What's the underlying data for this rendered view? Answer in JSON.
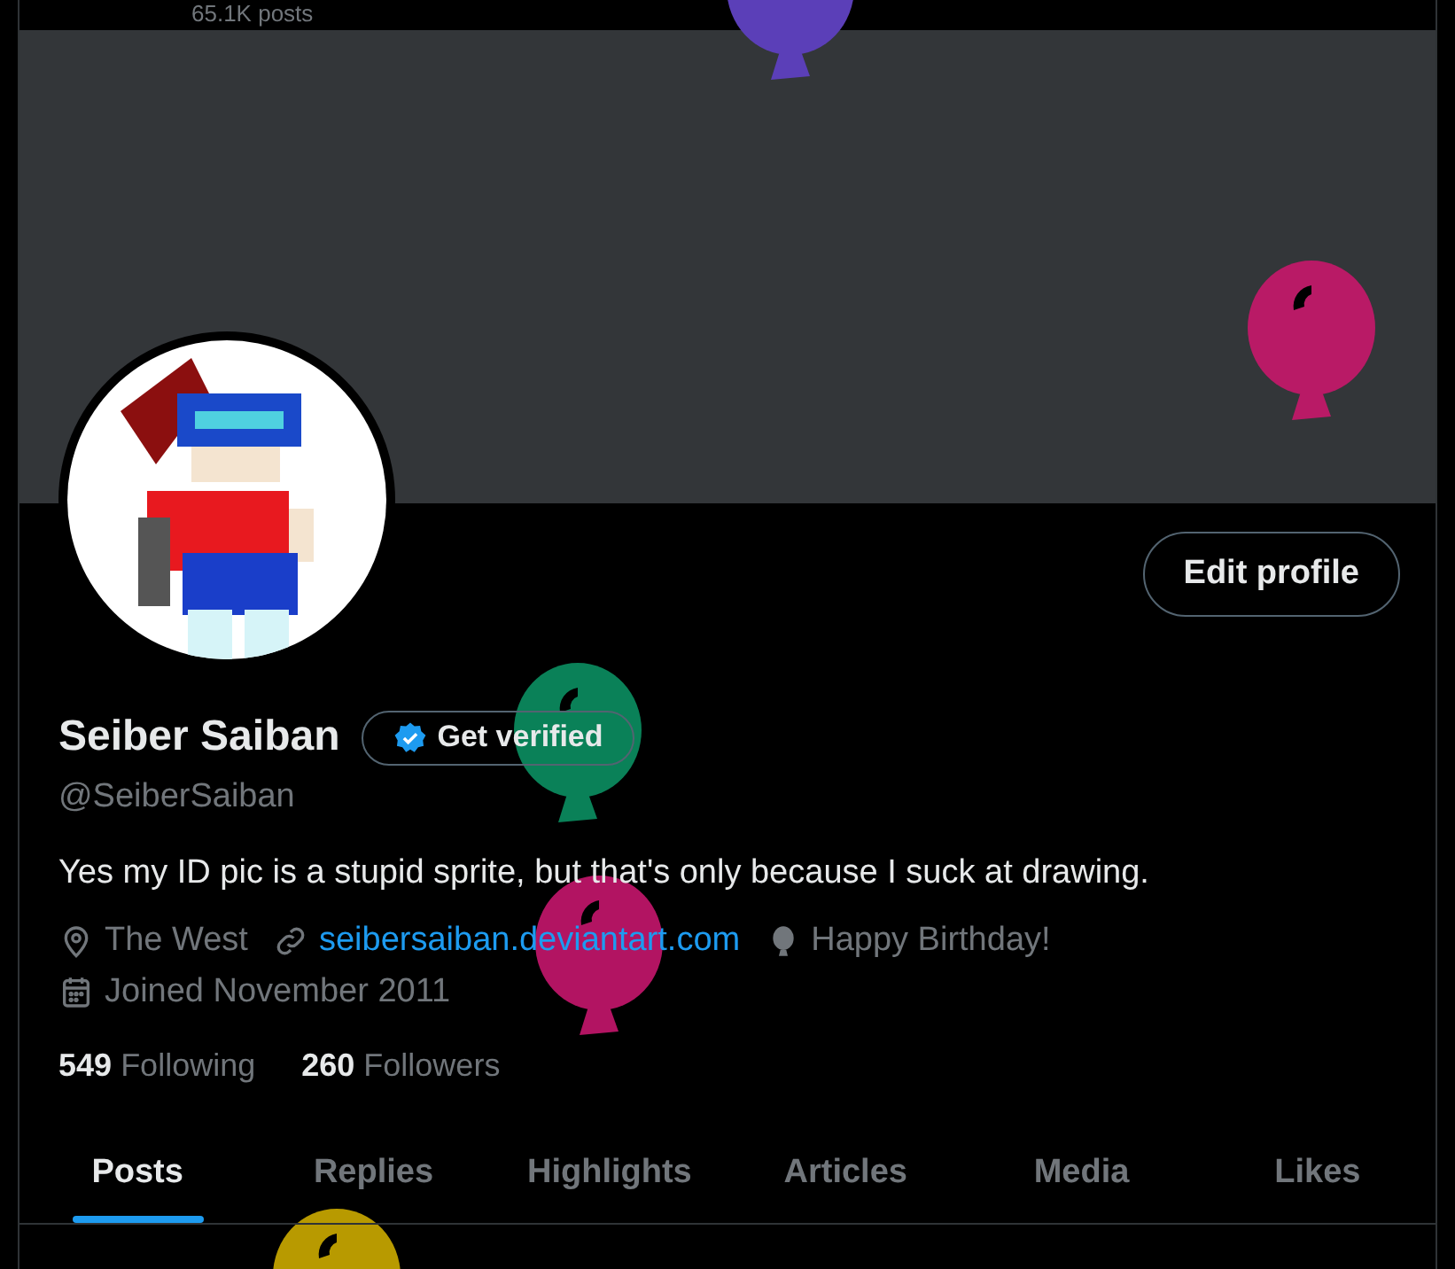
{
  "header": {
    "post_count": "65.1K posts"
  },
  "profile": {
    "edit_button": "Edit profile",
    "name": "Seiber Saiban",
    "verify_badge": "Get verified",
    "handle": "@SeiberSaiban",
    "bio": "Yes my ID pic is a stupid sprite, but that's only because I suck at drawing."
  },
  "details": [
    {
      "kind": "location",
      "text": "The West"
    },
    {
      "kind": "link",
      "text": "seibersaiban.deviantart.com"
    },
    {
      "kind": "birthday",
      "text": "Happy Birthday!"
    },
    {
      "kind": "joined",
      "text": "Joined November 2011"
    }
  ],
  "stats": [
    {
      "count": "549",
      "label": "Following"
    },
    {
      "count": "260",
      "label": "Followers"
    }
  ],
  "tabs": [
    {
      "label": "Posts",
      "selected": true
    },
    {
      "label": "Replies",
      "selected": false
    },
    {
      "label": "Highlights",
      "selected": false
    },
    {
      "label": "Articles",
      "selected": false
    },
    {
      "label": "Media",
      "selected": false
    },
    {
      "label": "Likes",
      "selected": false
    }
  ]
}
